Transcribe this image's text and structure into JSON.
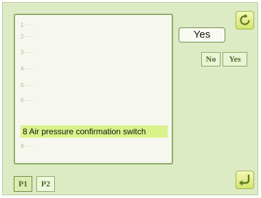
{
  "list": {
    "rows": [
      {
        "label": "1·····"
      },
      {
        "label": "2·····"
      },
      {
        "label": "3·····"
      },
      {
        "label": "4·····"
      },
      {
        "label": "5·····"
      },
      {
        "label": "6·····"
      },
      {
        "label": "8 Air pressure confirmation switch"
      },
      {
        "label": "9·····"
      }
    ],
    "selected_index": 6
  },
  "current_value": "Yes",
  "choices": {
    "no_label": "No",
    "yes_label": "Yes"
  },
  "pages": [
    {
      "label": "P1",
      "active": true
    },
    {
      "label": "P2",
      "active": false
    }
  ],
  "icons": {
    "reset": "rotate-arrow-icon",
    "confirm": "enter-return-icon"
  },
  "colors": {
    "background": "#dcebc4",
    "selection": "#d9f28a",
    "button": "#e3eca0"
  }
}
